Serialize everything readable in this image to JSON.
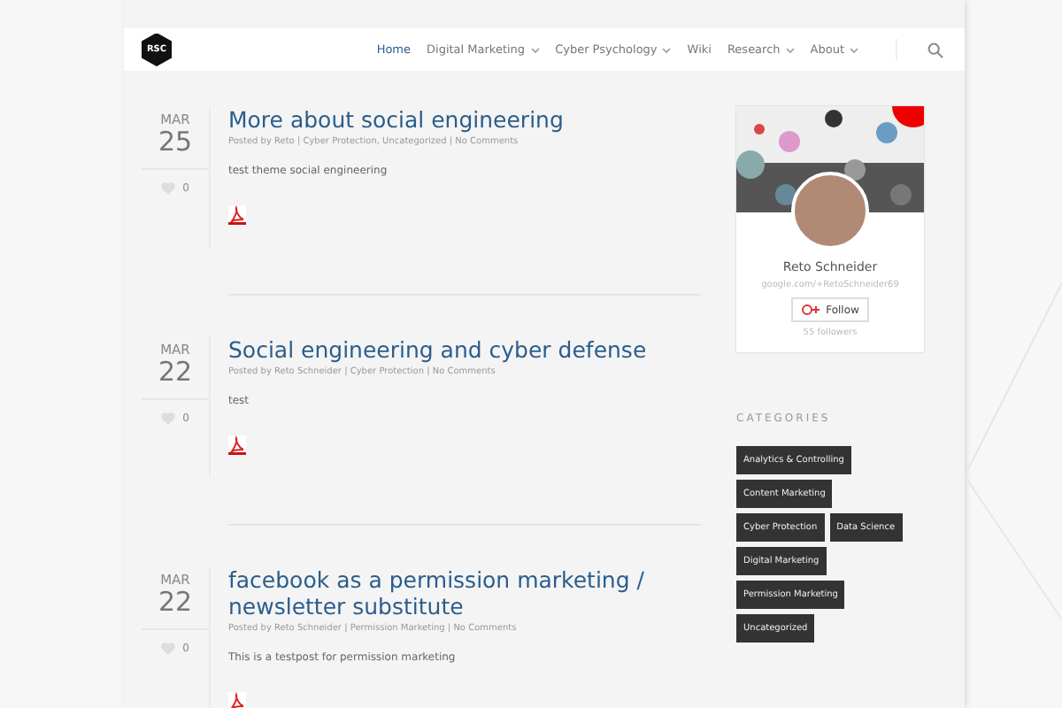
{
  "logo": "RSC",
  "nav": [
    {
      "label": "Home",
      "selected": true,
      "dropdown": false
    },
    {
      "label": "Digital Marketing",
      "selected": false,
      "dropdown": true
    },
    {
      "label": "Cyber Psychology",
      "selected": false,
      "dropdown": true
    },
    {
      "label": "Wiki",
      "selected": false,
      "dropdown": false
    },
    {
      "label": "Research",
      "selected": false,
      "dropdown": true
    },
    {
      "label": "About",
      "selected": false,
      "dropdown": true
    }
  ],
  "posts": [
    {
      "month": "MAR",
      "day": "25",
      "likes": "0",
      "title": "More about social engineering",
      "meta": "Posted by Reto | Cyber Protection, Uncategorized | No Comments",
      "excerpt": "test theme social engineering"
    },
    {
      "month": "MAR",
      "day": "22",
      "likes": "0",
      "title": "Social engineering and cyber defense",
      "meta": "Posted by Reto Schneider | Cyber Protection | No Comments",
      "excerpt": "test"
    },
    {
      "month": "MAR",
      "day": "22",
      "likes": "0",
      "title": "facebook as a permission marketing / newsletter substitute",
      "meta": "Posted by Reto Schneider | Permission Marketing | No Comments",
      "excerpt": "This is a testpost for permission marketing"
    }
  ],
  "profile": {
    "name": "Reto Schneider",
    "url": "google.com/+RetoSchneider69",
    "follow": "Follow",
    "followers": "55 followers"
  },
  "categories": {
    "heading": "CATEGORIES",
    "tags": [
      "Analytics & Controlling",
      "Content Marketing",
      "Cyber Protection",
      "Data Science",
      "Digital Marketing",
      "Permission Marketing",
      "Uncategorized"
    ]
  }
}
